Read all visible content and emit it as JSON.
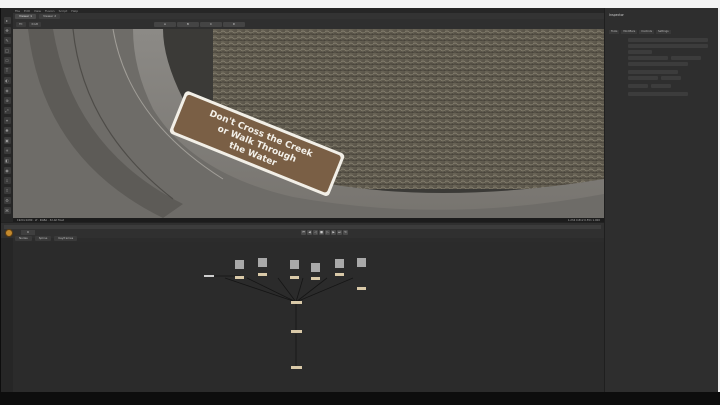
{
  "window": {
    "menu": [
      "File",
      "Edit",
      "View",
      "Fusion",
      "Script",
      "Help"
    ]
  },
  "viewer": {
    "tabs": [
      "Viewer 1",
      "Viewer 2"
    ],
    "toolbar": {
      "zoom": "Fit",
      "mode": "RGB",
      "buttons": [
        "A",
        "B",
        "C",
        "D"
      ]
    },
    "status_left": "1920×1080 · xf · RGBA · 32-bit float",
    "status_right": "1.234 0.812 0.551 1.000",
    "sign_text": [
      "Don't Cross the Creek",
      "or Walk Through",
      "the Water"
    ]
  },
  "timeline": {
    "frame": "0"
  },
  "node_editor": {
    "tabs": [
      "Nodes",
      "Spline",
      "Keyframes"
    ]
  },
  "inspector": {
    "title": "Inspector",
    "tabs": [
      "Tools",
      "Modifiers",
      "Controls",
      "Settings"
    ]
  },
  "colors": {
    "accent": "#c48a2d",
    "panel": "#2c2c2c"
  }
}
